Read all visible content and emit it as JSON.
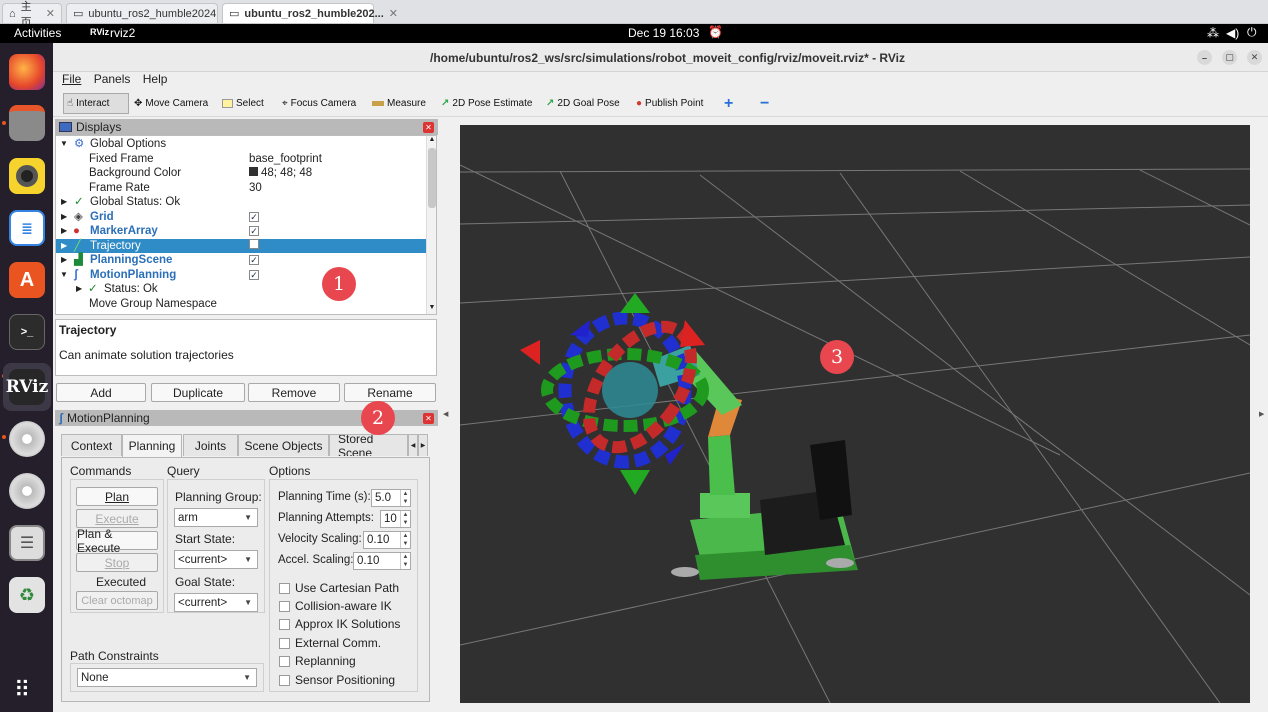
{
  "browser_tabs": [
    {
      "label": "主页"
    },
    {
      "label": "ubuntu_ros2_humble2024"
    },
    {
      "label": "ubuntu_ros2_humble202..."
    }
  ],
  "topbar": {
    "activities": "Activities",
    "app": "rviz2",
    "clock": "Dec 19  16:03"
  },
  "window": {
    "title": "/home/ubuntu/ros2_ws/src/simulations/robot_moveit_config/rviz/moveit.rviz* - RViz"
  },
  "menu": [
    "File",
    "Panels",
    "Help"
  ],
  "toolbar": {
    "interact": "Interact",
    "move_camera": "Move Camera",
    "select": "Select",
    "focus_camera": "Focus Camera",
    "measure": "Measure",
    "pose_estimate": "2D Pose Estimate",
    "goal_pose": "2D Goal Pose",
    "publish_point": "Publish Point"
  },
  "displays": {
    "title": "Displays",
    "rows": [
      {
        "label": "Global Options",
        "value": ""
      },
      {
        "label": "Fixed Frame",
        "value": "base_footprint"
      },
      {
        "label": "Background Color",
        "value": "48; 48; 48"
      },
      {
        "label": "Frame Rate",
        "value": "30"
      },
      {
        "label": "Global Status: Ok",
        "value": ""
      },
      {
        "label": "Grid",
        "value": ""
      },
      {
        "label": "MarkerArray",
        "value": ""
      },
      {
        "label": "Trajectory",
        "value": ""
      },
      {
        "label": "PlanningScene",
        "value": ""
      },
      {
        "label": "MotionPlanning",
        "value": ""
      },
      {
        "label": "Status: Ok",
        "value": ""
      },
      {
        "label": "Move Group Namespace",
        "value": ""
      }
    ],
    "desc_title": "Trajectory",
    "desc_text": "Can animate solution trajectories",
    "buttons": {
      "add": "Add",
      "duplicate": "Duplicate",
      "remove": "Remove",
      "rename": "Rename"
    }
  },
  "motion_planning": {
    "title": "MotionPlanning",
    "tabs": [
      "Context",
      "Planning",
      "Joints",
      "Scene Objects",
      "Stored Scene"
    ],
    "commands": {
      "header": "Commands",
      "plan": "Plan",
      "execute": "Execute",
      "plan_execute": "Plan & Execute",
      "stop": "Stop",
      "status": "Executed",
      "clear_octomap": "Clear octomap"
    },
    "query": {
      "header": "Query",
      "planning_group_label": "Planning Group:",
      "planning_group": "arm",
      "start_state_label": "Start State:",
      "start_state": "<current>",
      "goal_state_label": "Goal State:",
      "goal_state": "<current>"
    },
    "options": {
      "header": "Options",
      "planning_time_label": "Planning Time (s):",
      "planning_time": "5.0",
      "planning_attempts_label": "Planning Attempts:",
      "planning_attempts": "10",
      "velocity_label": "Velocity Scaling:",
      "velocity": "0.10",
      "accel_label": "Accel. Scaling:",
      "accel": "0.10",
      "checks": [
        "Use Cartesian Path",
        "Collision-aware IK",
        "Approx IK Solutions",
        "External Comm.",
        "Replanning",
        "Sensor Positioning"
      ]
    },
    "path_constraints": {
      "header": "Path Constraints",
      "value": "None"
    }
  },
  "badges": [
    "1",
    "2",
    "3"
  ],
  "colors": {
    "highlight": "#308cc6",
    "viewport_bg": "#303030",
    "badge": "#e8474f",
    "dock": "#241f2a"
  }
}
